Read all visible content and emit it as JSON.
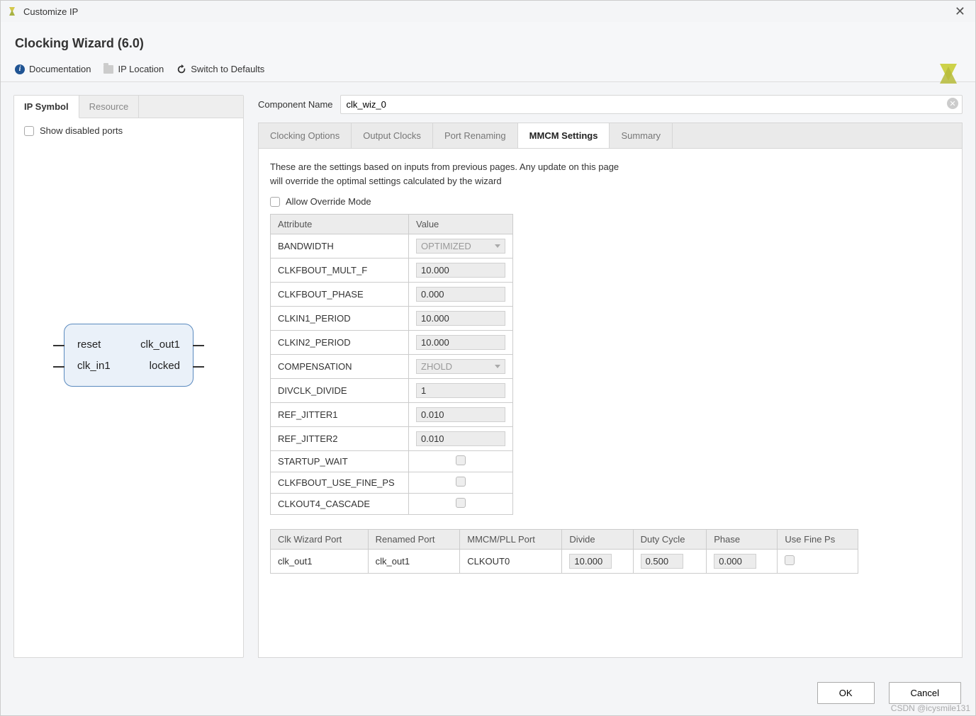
{
  "window": {
    "title": "Customize IP"
  },
  "header": {
    "title": "Clocking Wizard (6.0)"
  },
  "toolbar": {
    "documentation": "Documentation",
    "ip_location": "IP Location",
    "switch_defaults": "Switch to Defaults"
  },
  "left": {
    "tabs": [
      "IP Symbol",
      "Resource"
    ],
    "show_disabled_label": "Show disabled ports",
    "ip_ports": {
      "reset": "reset",
      "clk_in1": "clk_in1",
      "clk_out1": "clk_out1",
      "locked": "locked"
    }
  },
  "component": {
    "label": "Component Name",
    "value": "clk_wiz_0"
  },
  "main_tabs": [
    "Clocking Options",
    "Output Clocks",
    "Port Renaming",
    "MMCM Settings",
    "Summary"
  ],
  "mmcm": {
    "description_l1": "These are the settings based on inputs from previous pages. Any update on this page",
    "description_l2": "will override the optimal settings calculated by the wizard",
    "allow_override_label": "Allow Override Mode",
    "attr_header": "Attribute",
    "val_header": "Value",
    "rows": [
      {
        "attr": "BANDWIDTH",
        "value": "OPTIMIZED",
        "type": "select"
      },
      {
        "attr": "CLKFBOUT_MULT_F",
        "value": "10.000",
        "type": "text"
      },
      {
        "attr": "CLKFBOUT_PHASE",
        "value": "0.000",
        "type": "text"
      },
      {
        "attr": "CLKIN1_PERIOD",
        "value": "10.000",
        "type": "text"
      },
      {
        "attr": "CLKIN2_PERIOD",
        "value": "10.000",
        "type": "text"
      },
      {
        "attr": "COMPENSATION",
        "value": "ZHOLD",
        "type": "select"
      },
      {
        "attr": "DIVCLK_DIVIDE",
        "value": "1",
        "type": "text"
      },
      {
        "attr": "REF_JITTER1",
        "value": "0.010",
        "type": "text"
      },
      {
        "attr": "REF_JITTER2",
        "value": "0.010",
        "type": "text"
      },
      {
        "attr": "STARTUP_WAIT",
        "value": "",
        "type": "check"
      },
      {
        "attr": "CLKFBOUT_USE_FINE_PS",
        "value": "",
        "type": "check"
      },
      {
        "attr": "CLKOUT4_CASCADE",
        "value": "",
        "type": "check"
      }
    ],
    "port_headers": [
      "Clk Wizard Port",
      "Renamed Port",
      "MMCM/PLL Port",
      "Divide",
      "Duty Cycle",
      "Phase",
      "Use Fine Ps"
    ],
    "port_row": {
      "wiz": "clk_out1",
      "renamed": "clk_out1",
      "mmcm": "CLKOUT0",
      "divide": "10.000",
      "duty": "0.500",
      "phase": "0.000"
    }
  },
  "footer": {
    "ok": "OK",
    "cancel": "Cancel"
  },
  "watermark": "CSDN @icysmile131"
}
